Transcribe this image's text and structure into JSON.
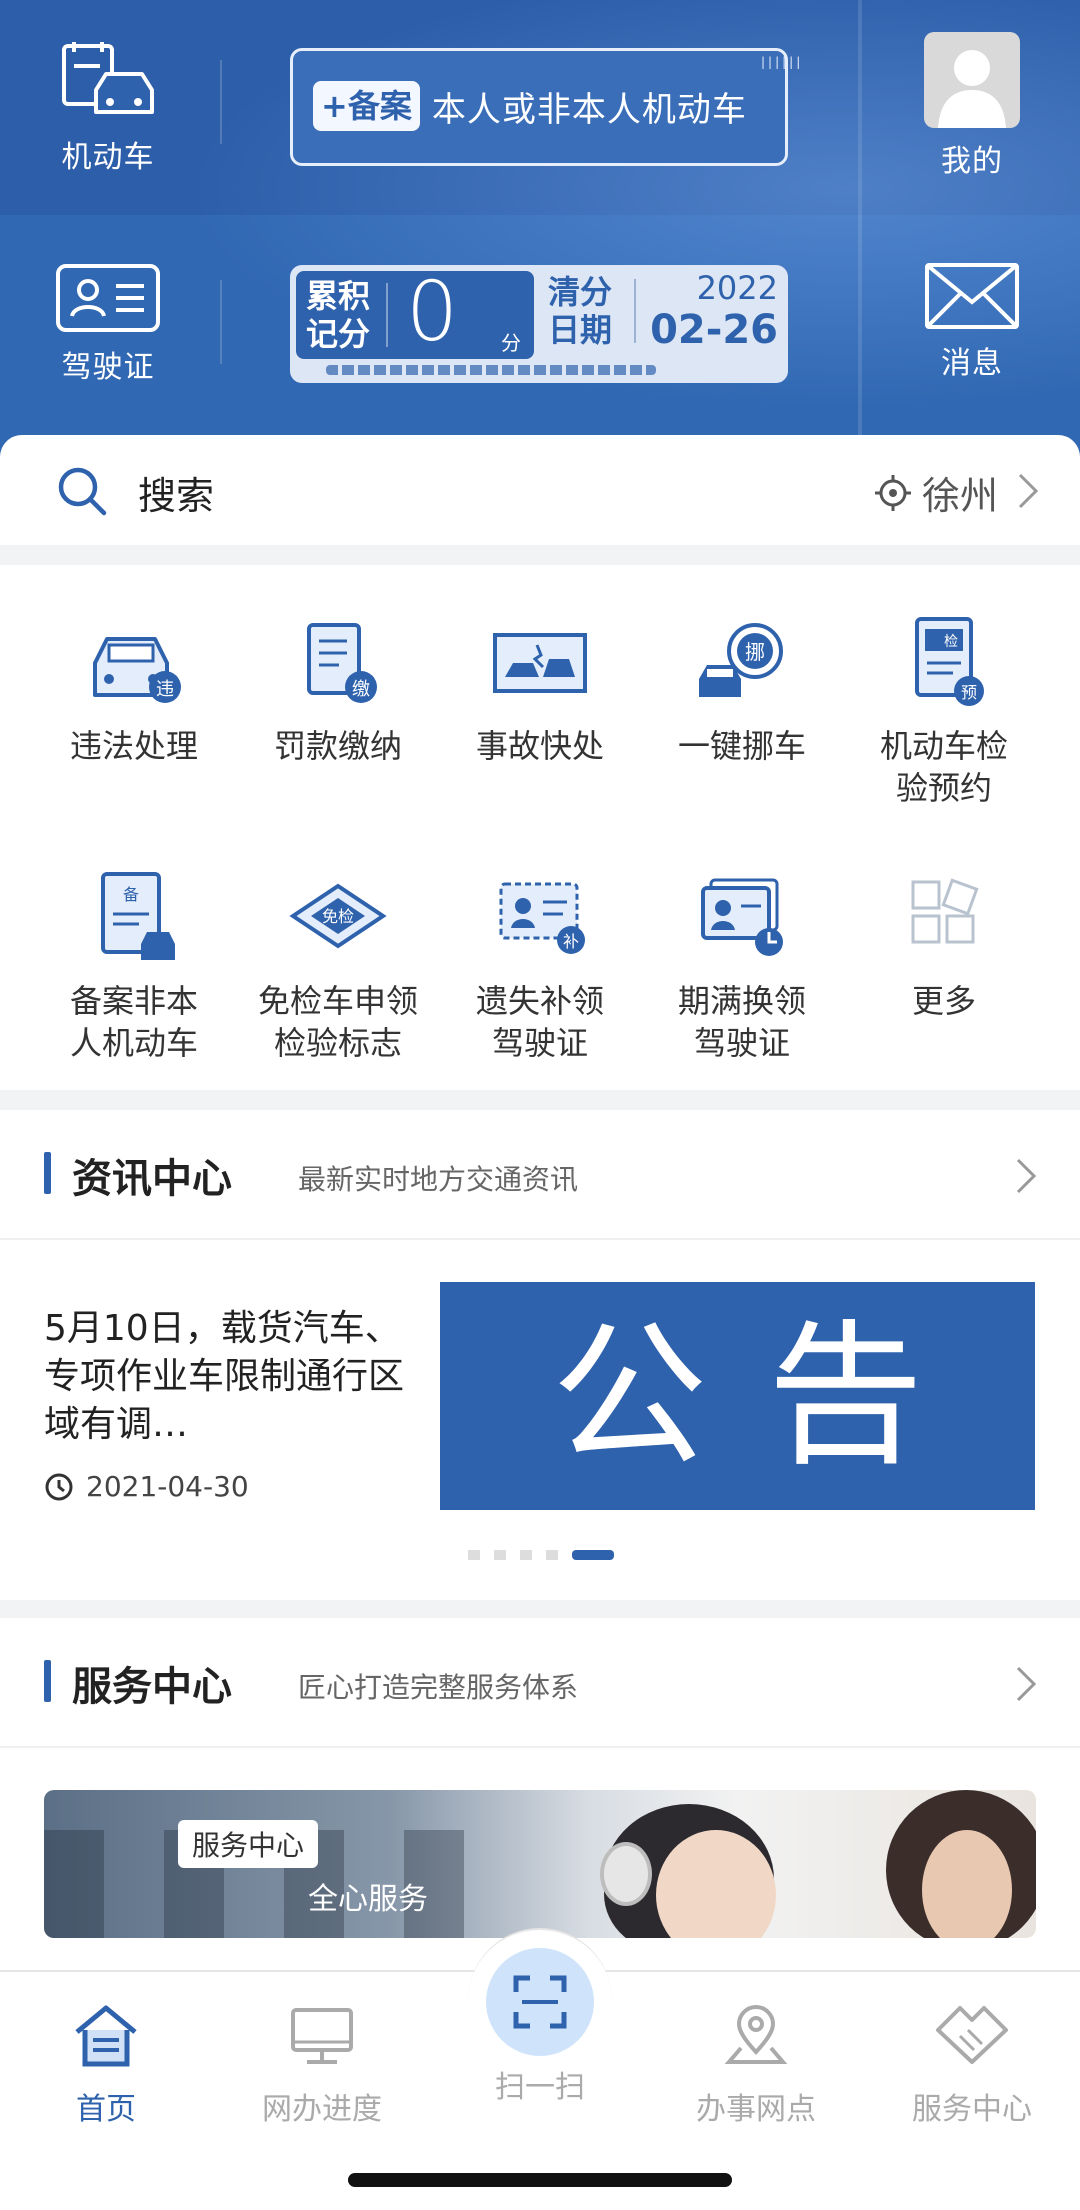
{
  "header": {
    "vehicle_label": "机动车",
    "license_label": "驾驶证",
    "mine_label": "我的",
    "message_label": "消息",
    "banner_register": {
      "badge": "+备案",
      "text": "本人或非本人机动车"
    },
    "points_banner": {
      "accum_label_line1": "累积",
      "accum_label_line2": "记分",
      "points": "0",
      "unit": "分",
      "clear_label_line1": "清分",
      "clear_label_line2": "日期",
      "year": "2022",
      "date": "02-26"
    }
  },
  "search": {
    "placeholder": "搜索",
    "city": "徐州"
  },
  "services": [
    {
      "label_line1": "违法处理",
      "label_line2": "",
      "icon": "car-violation-icon"
    },
    {
      "label_line1": "罚款缴纳",
      "label_line2": "",
      "icon": "fine-payment-icon"
    },
    {
      "label_line1": "事故快处",
      "label_line2": "",
      "icon": "accident-icon"
    },
    {
      "label_line1": "一键挪车",
      "label_line2": "",
      "icon": "move-car-icon"
    },
    {
      "label_line1": "机动车检",
      "label_line2": "验预约",
      "icon": "inspection-appointment-icon"
    },
    {
      "label_line1": "备案非本",
      "label_line2": "人机动车",
      "icon": "register-vehicle-icon"
    },
    {
      "label_line1": "免检车申领",
      "label_line2": "检验标志",
      "icon": "exempt-inspection-icon"
    },
    {
      "label_line1": "遗失补领",
      "label_line2": "驾驶证",
      "icon": "replace-license-icon"
    },
    {
      "label_line1": "期满换领",
      "label_line2": "驾驶证",
      "icon": "renew-license-icon"
    },
    {
      "label_line1": "更多",
      "label_line2": "",
      "icon": "more-icon"
    }
  ],
  "news": {
    "title": "资讯中心",
    "subtitle": "最新实时地方交通资讯",
    "item_text": "5月10日，载货汽车、专项作业车限制通行区域有调…",
    "item_date": "2021-04-30",
    "notice_text": "公告",
    "carousel_total": 5,
    "carousel_active": 5
  },
  "service_center": {
    "title": "服务中心",
    "subtitle": "匠心打造完整服务体系",
    "banner_tag": "服务中心",
    "banner_caption": "全心服务"
  },
  "tabs": [
    {
      "label": "首页",
      "icon": "home-icon",
      "active": true
    },
    {
      "label": "网办进度",
      "icon": "monitor-icon",
      "active": false
    },
    {
      "label": "扫一扫",
      "icon": "scan-icon",
      "active": false
    },
    {
      "label": "办事网点",
      "icon": "location-pin-icon",
      "active": false
    },
    {
      "label": "服务中心",
      "icon": "handshake-icon",
      "active": false
    }
  ],
  "colors": {
    "primary": "#2f62ad",
    "header_bg": "#2f62ad",
    "active_tab": "#2f62ad",
    "inactive_tab": "#aaaaaa"
  }
}
